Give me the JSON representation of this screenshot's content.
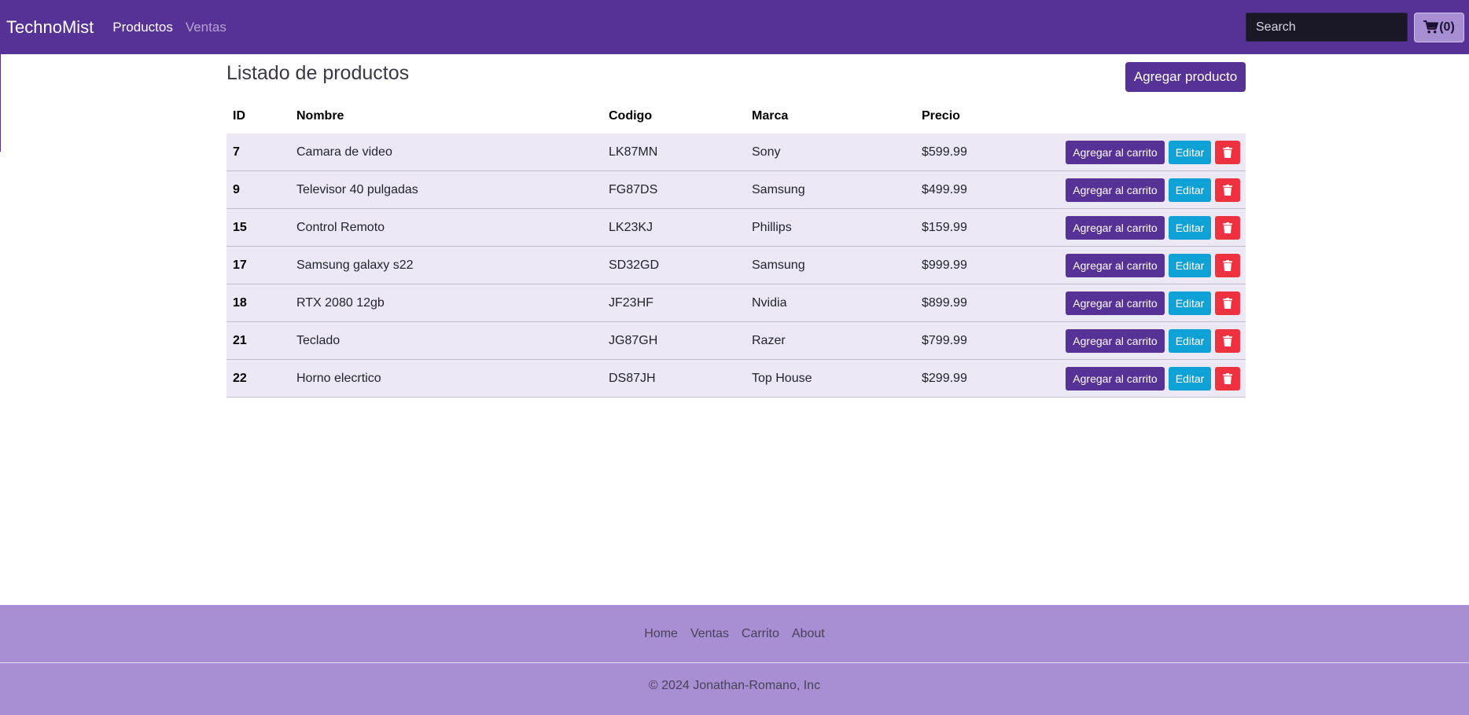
{
  "navbar": {
    "brand": "TechnoMist",
    "links": [
      {
        "label": "Productos"
      },
      {
        "label": "Ventas"
      }
    ],
    "search_placeholder": "Search",
    "cart_count": "(0)"
  },
  "main": {
    "title": "Listado de productos",
    "add_button": "Agregar producto",
    "columns": [
      "ID",
      "Nombre",
      "Codigo",
      "Marca",
      "Precio"
    ],
    "rows": [
      {
        "id": "7",
        "nombre": "Camara de video",
        "codigo": "LK87MN",
        "marca": "Sony",
        "precio": "$599.99"
      },
      {
        "id": "9",
        "nombre": "Televisor 40 pulgadas",
        "codigo": "FG87DS",
        "marca": "Samsung",
        "precio": "$499.99"
      },
      {
        "id": "15",
        "nombre": "Control Remoto",
        "codigo": "LK23KJ",
        "marca": "Phillips",
        "precio": "$159.99"
      },
      {
        "id": "17",
        "nombre": "Samsung galaxy s22",
        "codigo": "SD32GD",
        "marca": "Samsung",
        "precio": "$999.99"
      },
      {
        "id": "18",
        "nombre": "RTX 2080 12gb",
        "codigo": "JF23HF",
        "marca": "Nvidia",
        "precio": "$899.99"
      },
      {
        "id": "21",
        "nombre": "Teclado",
        "codigo": "JG87GH",
        "marca": "Razer",
        "precio": "$799.99"
      },
      {
        "id": "22",
        "nombre": "Horno elecrtico",
        "codigo": "DS87JH",
        "marca": "Top House",
        "precio": "$299.99"
      }
    ],
    "row_actions": {
      "cart": "Agregar al carrito",
      "edit": "Editar",
      "delete_icon": "trash-icon"
    }
  },
  "footer": {
    "links": [
      {
        "label": "Home"
      },
      {
        "label": "Ventas"
      },
      {
        "label": "Carrito"
      },
      {
        "label": "About"
      }
    ],
    "copyright": "© 2024 Jonathan-Romano, Inc"
  },
  "colors": {
    "primary": "#563296",
    "footer": "#a88fd4",
    "edit": "#0ea2d6",
    "delete": "#f0313f",
    "row": "#ece8f6"
  }
}
